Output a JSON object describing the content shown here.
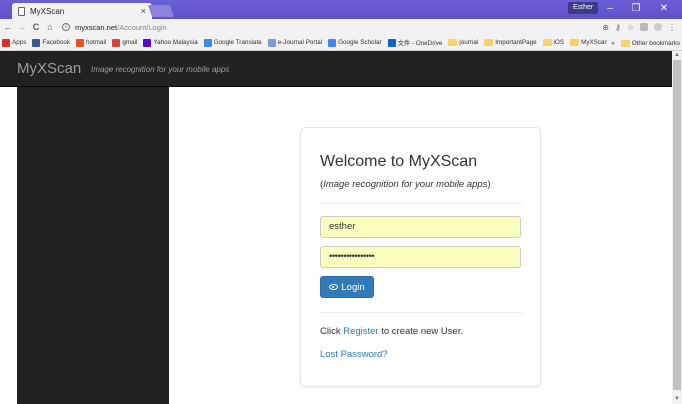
{
  "browser": {
    "tab_title": "MyXScan",
    "tab_close": "×",
    "profile_name": "Esther",
    "win_minimize": "–",
    "win_restore": "❐",
    "win_close": "✕",
    "nav_back": "←",
    "nav_forward": "→",
    "nav_reload": "C",
    "nav_home": "⌂",
    "url_host": "myxscan.net",
    "url_path": "/Account/Login",
    "zoom_icon": "⊕",
    "key_icon": "⚷",
    "star_icon": "☆",
    "menu_icon": "⋮",
    "bookmarks": [
      {
        "label": "Apps",
        "color": "#d93025"
      },
      {
        "label": "Facebook",
        "color": "#3b5998"
      },
      {
        "label": "hotmail",
        "color": "#f25022"
      },
      {
        "label": "gmail",
        "color": "#d44638"
      },
      {
        "label": "Yahoo Malaysia",
        "color": "#5f01d1"
      },
      {
        "label": "Google Translate",
        "color": "#4285f4"
      },
      {
        "label": "e-Journal Portal",
        "color": "#7b9cd6"
      },
      {
        "label": "Google Scholar",
        "color": "#4285f4"
      },
      {
        "label": "文件 - OneDrive",
        "color": "#0a64c8"
      },
      {
        "label": "journal",
        "color": "folder"
      },
      {
        "label": "ImportantPage",
        "color": "folder"
      },
      {
        "label": "iOS",
        "color": "folder"
      },
      {
        "label": "MyXScan",
        "color": "folder"
      },
      {
        "label": "PhD",
        "color": "folder"
      }
    ],
    "more_bookmarks": "»",
    "other_bookmarks": "Other bookmarks"
  },
  "navbar": {
    "brand": "MyXScan",
    "tagline": "Image recognition for your mobile apps"
  },
  "login": {
    "welcome": "Welcome to MyXScan",
    "subtitle_open": "(",
    "subtitle_text": "Image recognition for your mobile apps",
    "subtitle_close": ")",
    "username_value": "esther",
    "password_value": "••••••••••••••••",
    "login_button": "Login",
    "register_prefix": "Click ",
    "register_link": "Register",
    "register_suffix": " to create new User.",
    "lost_password": "Lost Password?"
  },
  "scroll": {
    "up": "▲",
    "down": "▼"
  }
}
